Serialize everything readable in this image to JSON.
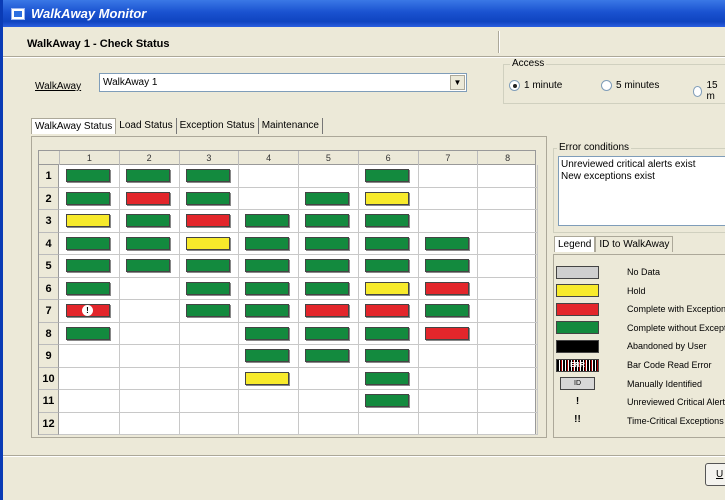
{
  "window": {
    "title": "WalkAway Monitor"
  },
  "header": {
    "title": "WalkAway 1 - Check Status"
  },
  "selector": {
    "label": "WalkAway",
    "value": "WalkAway 1"
  },
  "access": {
    "label": "Access",
    "options": [
      {
        "label": "1 minute",
        "checked": true
      },
      {
        "label": "5 minutes",
        "checked": false
      },
      {
        "label": "15 m",
        "checked": false
      }
    ]
  },
  "tabs": [
    "WalkAway Status",
    "Load Status",
    "Exception Status",
    "Maintenance"
  ],
  "grid": {
    "columns": [
      "1",
      "2",
      "3",
      "4",
      "5",
      "6",
      "7",
      "8"
    ],
    "rows": [
      "1",
      "2",
      "3",
      "4",
      "5",
      "6",
      "7",
      "8",
      "9",
      "10",
      "11",
      "12"
    ],
    "cells": [
      [
        "green",
        "green",
        "green",
        null,
        null,
        "green",
        null,
        null
      ],
      [
        "green",
        "red",
        "green",
        null,
        "green",
        "yellow",
        null,
        null
      ],
      [
        "yellow",
        "green",
        "red",
        "green",
        "green",
        "green",
        null,
        null
      ],
      [
        "green",
        "green",
        "yellow",
        "green",
        "green",
        "green",
        "green",
        null
      ],
      [
        "green",
        "green",
        "green",
        "green",
        "green",
        "green",
        "green",
        null
      ],
      [
        "green",
        null,
        "green",
        "green",
        "green",
        "yellow",
        "red",
        null
      ],
      [
        "red-alert",
        null,
        "green",
        "green",
        "red",
        "red",
        "green",
        null
      ],
      [
        "green",
        null,
        null,
        "green",
        "green",
        "green",
        "red",
        null
      ],
      [
        null,
        null,
        null,
        "green",
        "green",
        "green",
        null,
        null
      ],
      [
        null,
        null,
        null,
        "yellow",
        null,
        "green",
        null,
        null
      ],
      [
        null,
        null,
        null,
        null,
        null,
        "green",
        null,
        null
      ],
      [
        null,
        null,
        null,
        null,
        null,
        null,
        null,
        null
      ]
    ],
    "alert_glyph": "!"
  },
  "error_conditions": {
    "label": "Error conditions",
    "lines": [
      "Unreviewed critical alerts exist",
      "New exceptions exist"
    ]
  },
  "legend_tabs": [
    "Legend",
    "ID to WalkAway"
  ],
  "legend": [
    {
      "label": "No Data",
      "kind": "gray"
    },
    {
      "label": "Hold",
      "kind": "yellow"
    },
    {
      "label": "Complete with Exceptions",
      "kind": "red"
    },
    {
      "label": "Complete without Exceptions",
      "kind": "green"
    },
    {
      "label": "Abandoned by User",
      "kind": "black"
    },
    {
      "label": "Bar Code Read Error",
      "kind": "barcode"
    },
    {
      "label": "Manually Identified",
      "kind": "manual"
    },
    {
      "label": "Unreviewed Critical Alerts",
      "kind": "glyph1"
    },
    {
      "label": "Time-Critical Exceptions",
      "kind": "glyph2"
    }
  ],
  "legend_glyphs": {
    "barcode": "ERR",
    "manual": "ID",
    "glyph1": "!",
    "glyph2": "!!"
  },
  "colors": {
    "green": "#138a3e",
    "red": "#e3262b",
    "yellow": "#f7ea2b",
    "gray": "#cfcfcf",
    "black": "#000000"
  },
  "bottom_button": "U"
}
